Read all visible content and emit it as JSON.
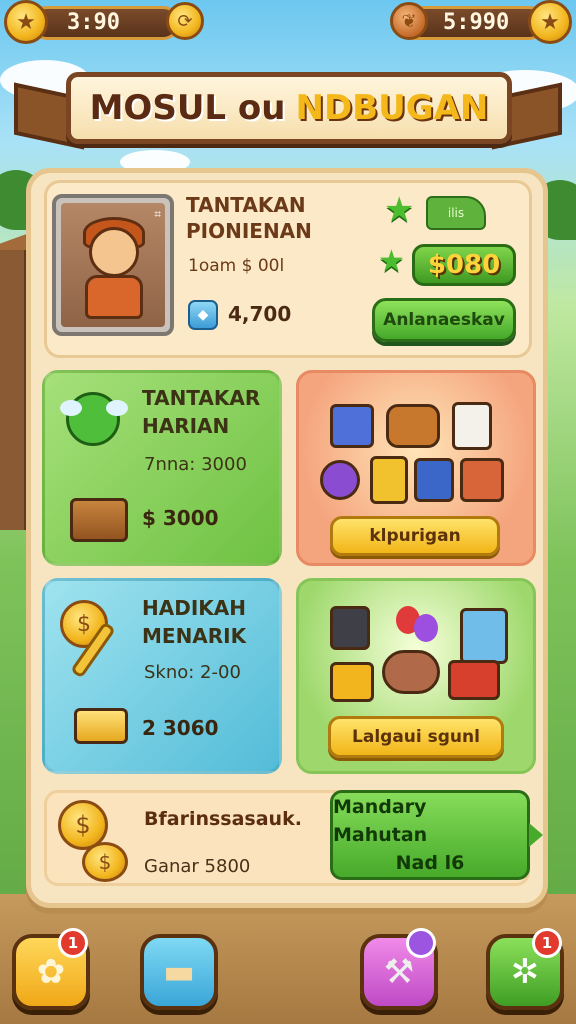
{
  "topbar": {
    "left_value": "3:90",
    "right_value": "5:990",
    "left_icon": "star-icon",
    "right_icon": "star-icon"
  },
  "title": {
    "part1": "MOSUL ou",
    "part2": "NDBUGAN"
  },
  "hero": {
    "title_line1": "TANTAKAN",
    "title_line2": "PIONIENAN",
    "cost": "1oam $ 00l",
    "gem_value": "4,700",
    "badge_text": "ilis",
    "price": "$080",
    "action_label": "Anlanaeskav"
  },
  "tiles": {
    "daily": {
      "title_line1": "TANTAKAR",
      "title_line2": "HARIAN",
      "text": "7nna: 3000",
      "value": "$ 3000"
    },
    "shop": {
      "button_label": "klpurigan"
    },
    "rewards": {
      "title_line1": "HADIKAH",
      "title_line2": "MENARIK",
      "text": "Skno: 2-00",
      "value": "2 3060"
    },
    "bonus": {
      "button_label": "Lalgaui sgunl"
    }
  },
  "strip": {
    "title": "Bfarinssasauk.",
    "subtitle": "Ganar 5800",
    "button_line1": "Mandary Mahutan",
    "button_line2": "Nad l6"
  },
  "nav": {
    "badge1": "1",
    "badge3": "",
    "badge4": "1"
  },
  "colors": {
    "panel": "#f7e4c0",
    "green_button": "#45a82a",
    "yellow_button": "#f2b518",
    "wood": "#7a4522"
  }
}
